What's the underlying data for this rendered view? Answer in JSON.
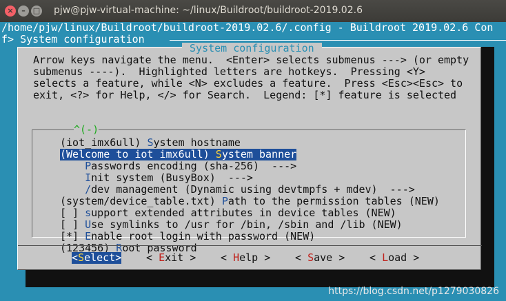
{
  "window": {
    "title": "pjw@pjw-virtual-machine: ~/linux/Buildroot/buildroot-2019.02.6",
    "close_glyph": "×",
    "minimize_glyph": "–",
    "maximize_glyph": "□"
  },
  "header": {
    "line1": "/home/pjw/linux/Buildroot/buildroot-2019.02.6/.config - Buildroot 2019.02.6 Con",
    "line2": "f> System configuration"
  },
  "dialog": {
    "title": " System configuration ",
    "help": [
      "Arrow keys navigate the menu.  <Enter> selects submenus ---> (or empty",
      "submenus ----).  Highlighted letters are hotkeys.  Pressing <Y>",
      "selects a feature, while <N> excludes a feature.  Press <Esc><Esc> to",
      "exit, <?> for Help, </> for Search.  Legend: [*] feature is selected"
    ],
    "scroll_up": "^(-)",
    "scroll_down": "↓(+)"
  },
  "menu": {
    "items": [
      {
        "pre": "(iot_imx6ull) ",
        "hotkey": "S",
        "post": "ystem hostname",
        "selected": false
      },
      {
        "pre": "(Welcome to iot imx6ull) ",
        "hotkey": "S",
        "post": "ystem banner",
        "selected": true
      },
      {
        "pre": "    ",
        "hotkey": "P",
        "post": "asswords encoding (sha-256)  --->",
        "selected": false
      },
      {
        "pre": "    ",
        "hotkey": "I",
        "post": "nit system (BusyBox)  --->",
        "selected": false
      },
      {
        "pre": "    ",
        "hotkey": "/",
        "post": "dev management (Dynamic using devtmpfs + mdev)  --->",
        "selected": false
      },
      {
        "pre": "(system/device_table.txt) ",
        "hotkey": "P",
        "post": "ath to the permission tables (NEW)",
        "selected": false
      },
      {
        "pre": "[ ] ",
        "hotkey": "s",
        "post": "upport extended attributes in device tables (NEW)",
        "selected": false
      },
      {
        "pre": "[ ] ",
        "hotkey": "U",
        "post": "se symlinks to /usr for /bin, /sbin and /lib (NEW)",
        "selected": false
      },
      {
        "pre": "[*] ",
        "hotkey": "E",
        "post": "nable root login with password (NEW)",
        "selected": false
      },
      {
        "pre": "(123456) ",
        "hotkey": "R",
        "post": "oot password",
        "selected": false
      }
    ]
  },
  "buttons": [
    {
      "pre": "<",
      "hotkey": "S",
      "post": "elect>",
      "active": true
    },
    {
      "pre": "< ",
      "hotkey": "E",
      "post": "xit >",
      "active": false
    },
    {
      "pre": "< ",
      "hotkey": "H",
      "post": "elp >",
      "active": false
    },
    {
      "pre": "< ",
      "hotkey": "S",
      "post": "ave >",
      "active": false
    },
    {
      "pre": "< ",
      "hotkey": "L",
      "post": "oad >",
      "active": false
    }
  ],
  "watermark": "https://blog.csdn.net/p1279030826"
}
